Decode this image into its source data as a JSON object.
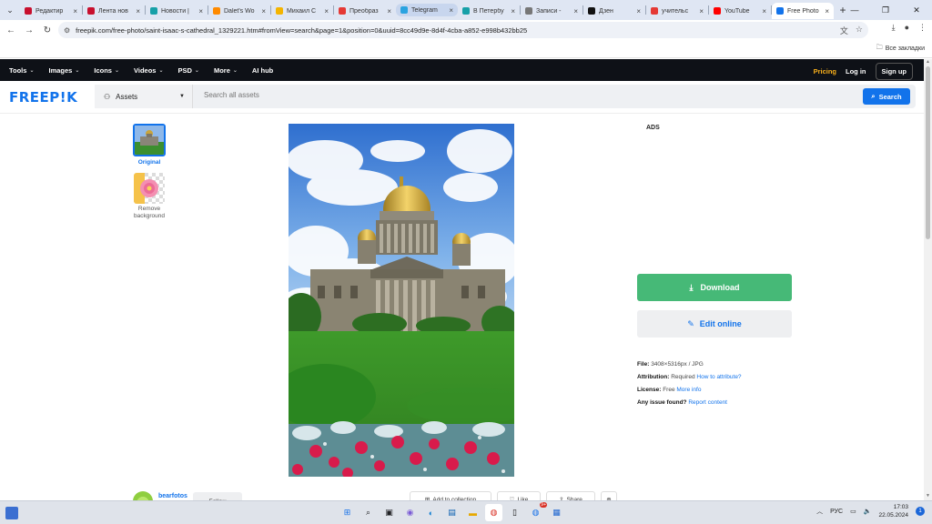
{
  "browser": {
    "tabs": [
      {
        "label": "Редактир",
        "color": "#c8102e"
      },
      {
        "label": "Лента нов",
        "color": "#c8102e"
      },
      {
        "label": "Новости |",
        "color": "#17a0a8"
      },
      {
        "label": "Dalet's Wo",
        "color": "#ff8a00"
      },
      {
        "label": "Михаил С",
        "color": "#f4b400"
      },
      {
        "label": "Преобраз",
        "color": "#e53935"
      },
      {
        "label": "Telegram",
        "color": "#2aa3e0"
      },
      {
        "label": "В Петербу",
        "color": "#17a0a8"
      },
      {
        "label": "Записи - ",
        "color": "#777777"
      },
      {
        "label": "Дзен",
        "color": "#111111"
      },
      {
        "label": "учительс",
        "color": "#e53935"
      },
      {
        "label": "YouTube",
        "color": "#ff0000"
      },
      {
        "label": "Free Photo",
        "color": "#1273eb"
      }
    ],
    "tab_close": "×",
    "url": "freepik.com/free-photo/saint-isaac-s-cathedral_1329221.htm#fromView=search&page=1&position=0&uuid=8cc49d9e-8d4f-4cba-a852-e998b432bb25",
    "bookmarks_label": "Все закладки"
  },
  "nav": {
    "items": [
      "Tools",
      "Images",
      "Icons",
      "Videos",
      "PSD",
      "More",
      "AI hub"
    ],
    "pricing": "Pricing",
    "login": "Log in",
    "signup": "Sign up"
  },
  "search": {
    "logo": "FREEP!K",
    "asset_type": "Assets",
    "placeholder": "Search all assets",
    "button": "Search"
  },
  "thumbs": {
    "original": "Original",
    "remove_bg": "Remove background"
  },
  "panel": {
    "ads": "ADS",
    "download": "Download",
    "edit": "Edit online",
    "file_label": "File:",
    "file_value": "3408×5316px / JPG",
    "attribution_label": "Attribution:",
    "attribution_value": "Required",
    "attribution_link": "How to attribute?",
    "license_label": "License:",
    "license_value": "Free",
    "license_link": "More info",
    "issue_label": "Any issue found?",
    "issue_link": "Report content"
  },
  "bottom": {
    "author": "bearfotos",
    "follow": "Follow",
    "add_collection": "Add to collection",
    "like": "Like",
    "share": "Share"
  },
  "taskbar": {
    "lang": "РУС",
    "time": "17:03",
    "date": "22.05.2024",
    "notifications": "1",
    "chrome_badge": "9+"
  }
}
